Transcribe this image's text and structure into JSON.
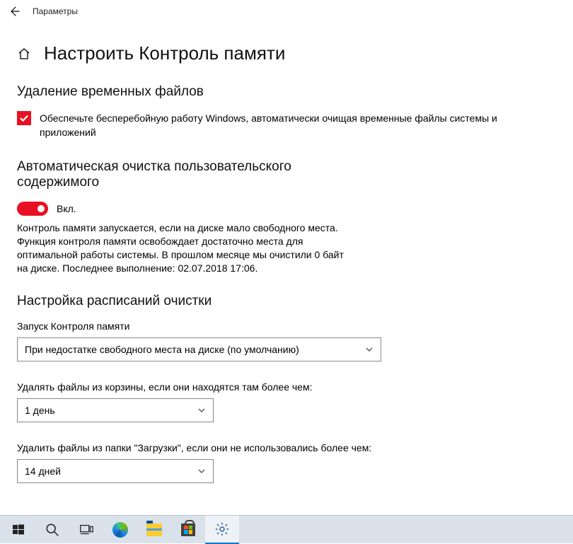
{
  "titlebar": {
    "title": "Параметры"
  },
  "header": {
    "title": "Настроить Контроль памяти"
  },
  "temp_files": {
    "heading": "Удаление временных файлов",
    "checkbox_label": "Обеспечьте бесперебойную работу Windows, автоматически очищая временные файлы системы и приложений"
  },
  "auto_cleanup": {
    "heading": "Автоматическая очистка пользовательского содержимого",
    "toggle_state": "Вкл.",
    "description": "Контроль памяти запускается, если на диске мало свободного места. Функция контроля памяти освобождает достаточно места для оптимальной работы системы. В прошлом месяце мы очистили 0 байт на диске. Последнее выполнение: 02.07.2018 17:06."
  },
  "schedule": {
    "heading": "Настройка расписаний очистки",
    "run_label": "Запуск Контроля памяти",
    "run_value": "При недостатке свободного места на диске (по умолчанию)",
    "recycle_label": "Удалять файлы из корзины, если они находятся там более чем:",
    "recycle_value": "1 день",
    "downloads_label": "Удалить файлы из папки \"Загрузки\", если они не использовались более чем:",
    "downloads_value": "14 дней"
  }
}
